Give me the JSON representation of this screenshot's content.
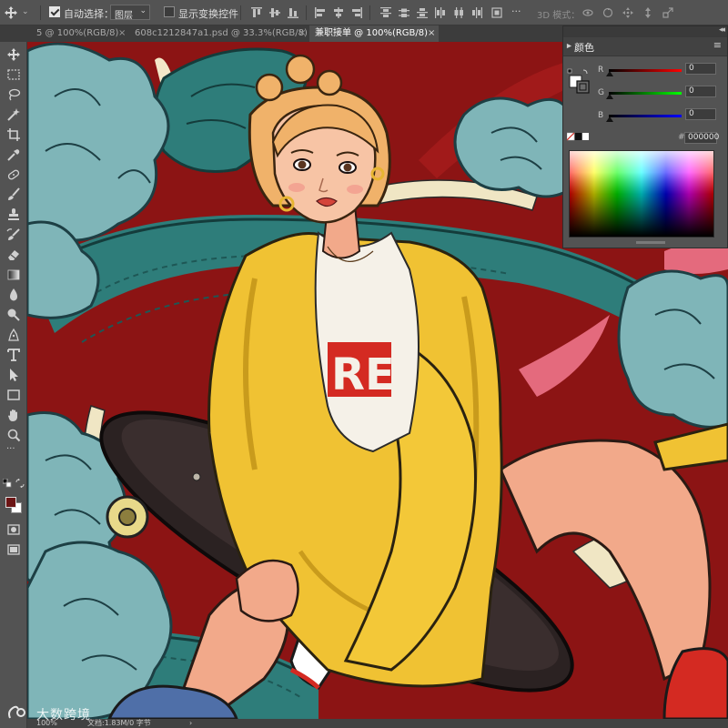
{
  "options_bar": {
    "auto_select_label": "自动选择：",
    "auto_select_checked": true,
    "auto_select_target": "图层",
    "show_transform_label": "显示变换控件",
    "show_transform_checked": false,
    "mode_3d_label": "3D 模式："
  },
  "tabs": [
    {
      "label": "5 @ 100%(RGB/8)",
      "close": "×",
      "active": false
    },
    {
      "label": "608c1212847a1.psd @ 33.3%(RGB/8) *",
      "close": "×",
      "active": false
    },
    {
      "label": "兼职接单 @ 100%(RGB/8)",
      "close": "×",
      "active": true
    }
  ],
  "color_panel": {
    "collapse": "◂◂",
    "title": "颜色",
    "menu": "≡",
    "channels": [
      {
        "label": "R",
        "value": "0",
        "color": "#ff2a2a"
      },
      {
        "label": "G",
        "value": "0",
        "color": "#2ad22a"
      },
      {
        "label": "B",
        "value": "0",
        "color": "#3030ff"
      }
    ],
    "hex_label": "#",
    "hex_value": "000000"
  },
  "toolbar": {
    "foreground_color": "#6b1414",
    "background_color": "#ffffff"
  },
  "status_bar": {
    "zoom": "100%",
    "doc_info": "文档:1.83M/0 字节",
    "arrow": "›"
  },
  "watermark": "大数跨境"
}
